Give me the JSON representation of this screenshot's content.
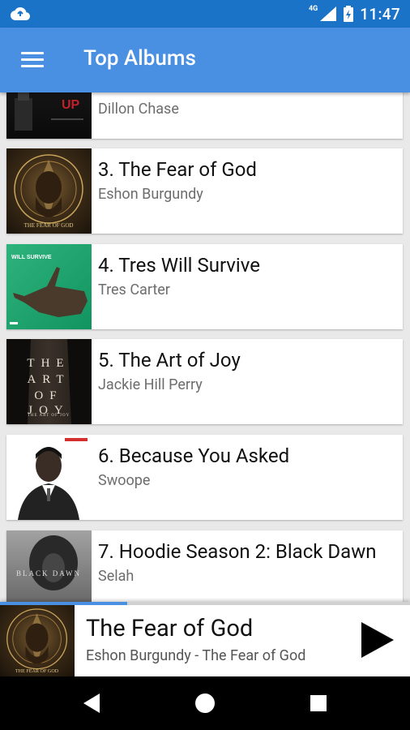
{
  "status_bar": {
    "network": "4G",
    "time": "11:47"
  },
  "app_bar": {
    "title": "Top Albums",
    "menu_icon": "hamburger-menu-icon"
  },
  "albums": [
    {
      "title": "",
      "artist": "Dillon Chase",
      "art_text": "UP"
    },
    {
      "title": "3. The Fear of God",
      "artist": "Eshon Burgundy",
      "art_text": "THE FEAR OF GOD"
    },
    {
      "title": "4. Tres Will Survive",
      "artist": "Tres Carter",
      "art_text": "WILL SURVIVE"
    },
    {
      "title": "5. The Art of Joy",
      "artist": "Jackie Hill Perry",
      "art_text": "THE ART OF JOY"
    },
    {
      "title": "6. Because You Asked",
      "artist": "Swoope",
      "art_text": ""
    },
    {
      "title": "7. Hoodie Season 2: Black Dawn",
      "artist": "Selah",
      "art_text": "BLACK DAWN"
    }
  ],
  "now_playing": {
    "title": "The Fear of God",
    "subtitle": "Eshon Burgundy - The Fear of God",
    "progress": 0.31
  },
  "nav_bar": {
    "back": "back-icon",
    "home": "home-icon",
    "recents": "recents-icon"
  },
  "colors": {
    "status_bar": "#1b73c8",
    "app_bar": "#4a90e2",
    "accent": "#4a90e2"
  }
}
